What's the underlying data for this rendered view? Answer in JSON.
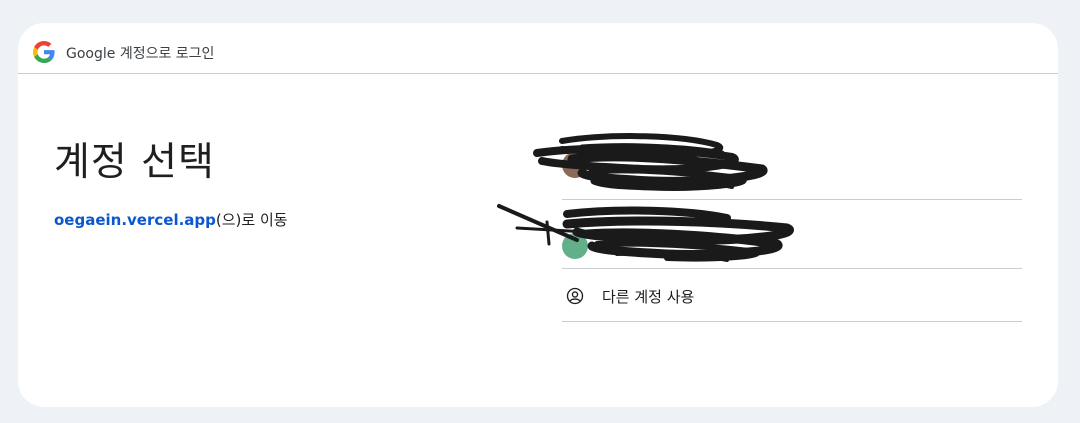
{
  "header": {
    "title": "Google 계정으로 로그인"
  },
  "main": {
    "title": "계정 선택",
    "subtitle_link": "oegaein.vercel.app",
    "subtitle_suffix": "(으)로 이동"
  },
  "accounts": [
    {
      "avatar_color": "#8a6a5b"
    },
    {
      "avatar_color": "#62b08a"
    }
  ],
  "use_other": {
    "label": "다른 계정 사용",
    "icon": "account-circle-icon"
  },
  "colors": {
    "accent": "#0b57d0",
    "background": "#eef1f5"
  }
}
